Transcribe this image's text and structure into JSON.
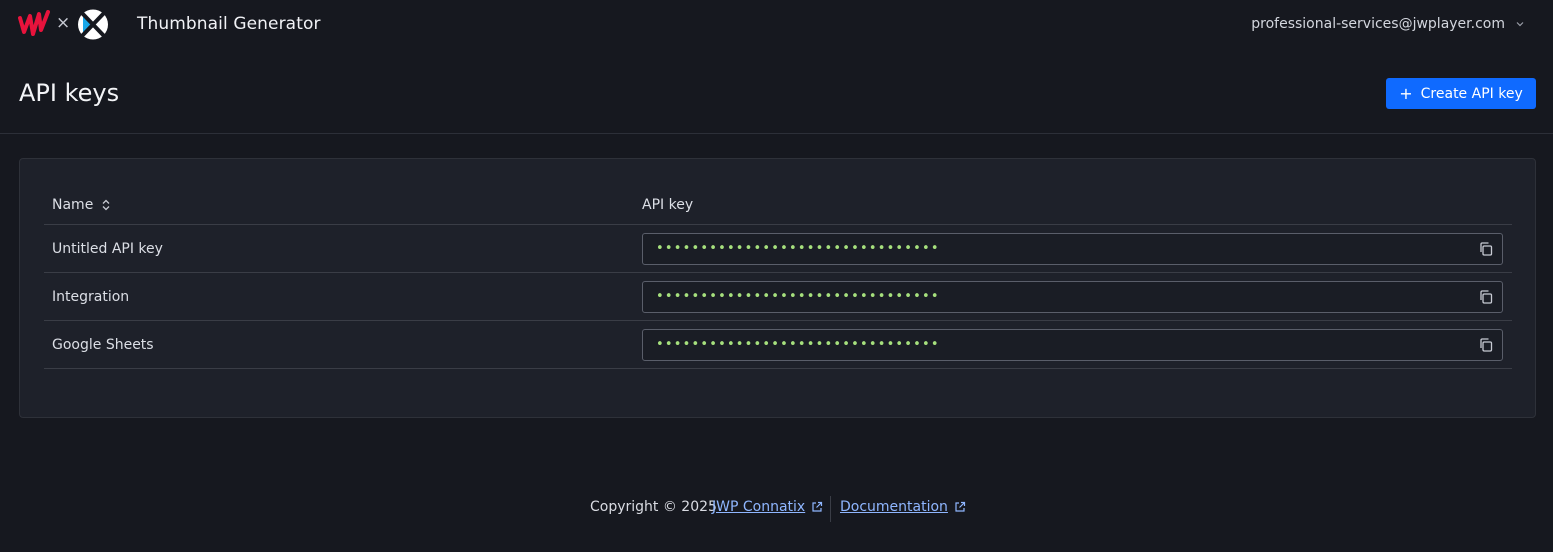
{
  "header": {
    "logo_separator": "×",
    "app_title": "Thumbnail Generator",
    "user_email": "professional-services@jwplayer.com"
  },
  "page": {
    "title": "API keys",
    "create_button_label": "Create API key",
    "create_button_icon": "plus-icon"
  },
  "table": {
    "columns": [
      "Name",
      "API key"
    ],
    "rows": [
      {
        "name": "Untitled API key",
        "key_masked": "••••••••••••••••••••••••••••••••"
      },
      {
        "name": "Integration",
        "key_masked": "••••••••••••••••••••••••••••••••"
      },
      {
        "name": "Google Sheets",
        "key_masked": "••••••••••••••••••••••••••••••••"
      }
    ]
  },
  "footer": {
    "copyright": "Copyright © 2025",
    "links": [
      "JWP Connatix",
      "Documentation"
    ]
  },
  "colors": {
    "background": "#16181f",
    "card": "#1e212a",
    "primary": "#0f6aff",
    "link": "#8fb6ff",
    "key_dots": "#a6e07d",
    "brand_red": "#e8133c"
  }
}
